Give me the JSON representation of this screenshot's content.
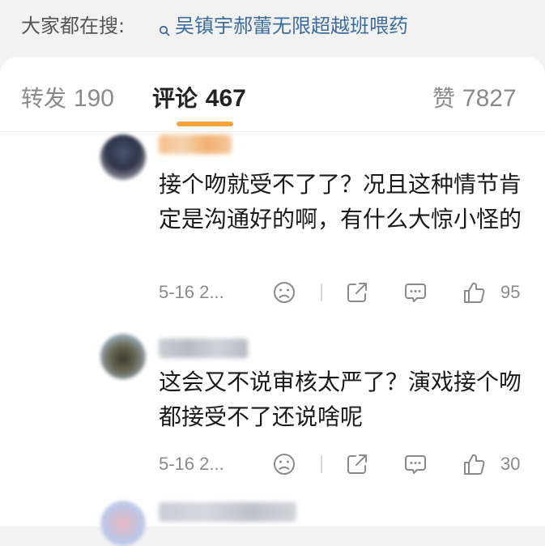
{
  "search": {
    "prefix": "大家都在搜:",
    "query": "吴镇宇郝蕾无限超越班喂药"
  },
  "tabs": {
    "repost_label": "转发",
    "repost_count": "190",
    "comment_label": "评论",
    "comment_count": "467",
    "like_label": "赞",
    "like_count": "7827",
    "active": "comment"
  },
  "comments": [
    {
      "text": "接个吻就受不了了？况且这种情节肯定是沟通好的啊，有什么大惊小怪的",
      "time": "5-16 2...",
      "likes": "95"
    },
    {
      "text": "这会又不说审核太严了？演戏接个吻都接受不了还说啥呢",
      "time": "5-16 2...",
      "likes": "30"
    }
  ],
  "colors": {
    "accent": "#f6a33c",
    "link": "#3d6d9c"
  }
}
